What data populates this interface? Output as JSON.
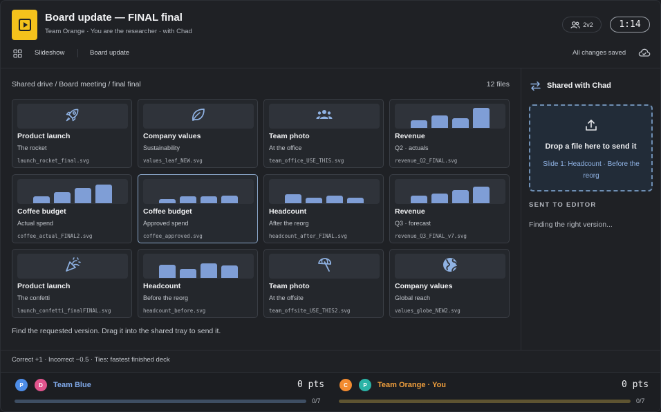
{
  "header": {
    "title": "Board update — FINAL final",
    "subtitle": "Team Orange · You are the researcher · with Chad",
    "mode_badge": "2v2",
    "timer": "1:14",
    "nav": {
      "slideshow": "Slideshow",
      "deck": "Board update"
    },
    "saved_status": "All changes saved"
  },
  "main": {
    "breadcrumb": "Shared drive / Board meeting / final final",
    "file_count": "12 files",
    "instruction": "Find the requested version. Drag it into the shared tray to send it.",
    "files": [
      {
        "title": "Product launch",
        "subtitle": "The rocket",
        "filename": "launch_rocket_final.svg",
        "thumb": "rocket-icon"
      },
      {
        "title": "Company values",
        "subtitle": "Sustainability",
        "filename": "values_leaf_NEW.svg",
        "thumb": "leaf-icon"
      },
      {
        "title": "Team photo",
        "subtitle": "At the office",
        "filename": "team_office_USE_THIS.svg",
        "thumb": "people-icon"
      },
      {
        "title": "Revenue",
        "subtitle": "Q2 · actuals",
        "filename": "revenue_Q2_FINAL.svg",
        "thumb": "bar-chart",
        "bars": [
          0.35,
          0.55,
          0.45,
          0.9
        ]
      },
      {
        "title": "Coffee budget",
        "subtitle": "Actual spend",
        "filename": "coffee_actual_FINAL2.svg",
        "thumb": "bar-chart",
        "bars": [
          0.3,
          0.5,
          0.7,
          0.85
        ]
      },
      {
        "title": "Coffee budget",
        "subtitle": "Approved spend",
        "filename": "coffee_approved.svg",
        "thumb": "bar-chart",
        "bars": [
          0.2,
          0.3,
          0.3,
          0.35
        ],
        "selected": true
      },
      {
        "title": "Headcount",
        "subtitle": "After the reorg",
        "filename": "headcount_after_FINAL.svg",
        "thumb": "bar-chart",
        "bars": [
          0.4,
          0.25,
          0.35,
          0.25
        ]
      },
      {
        "title": "Revenue",
        "subtitle": "Q3 · forecast",
        "filename": "revenue_Q3_FINAL_v7.svg",
        "thumb": "bar-chart",
        "bars": [
          0.35,
          0.45,
          0.6,
          0.75
        ]
      },
      {
        "title": "Product launch",
        "subtitle": "The confetti",
        "filename": "launch_confetti_finalFINAL.svg",
        "thumb": "confetti-icon"
      },
      {
        "title": "Headcount",
        "subtitle": "Before the reorg",
        "filename": "headcount_before.svg",
        "thumb": "bar-chart",
        "bars": [
          0.6,
          0.4,
          0.65,
          0.55
        ]
      },
      {
        "title": "Team photo",
        "subtitle": "At the offsite",
        "filename": "team_offsite_USE_THIS2.svg",
        "thumb": "beach-umbrella-icon"
      },
      {
        "title": "Company values",
        "subtitle": "Global reach",
        "filename": "values_globe_NEW2.svg",
        "thumb": "globe-icon"
      }
    ]
  },
  "side": {
    "title": "Shared with Chad",
    "drop_title": "Drop a file here to send it",
    "drop_sub": "Slide 1: Headcount · Before the reorg",
    "sent_label": "SENT TO EDITOR",
    "sent_status": "Finding the right version..."
  },
  "footer": {
    "rules": "Correct +1 · Incorrect −0.5 · Ties: fastest finished deck",
    "teams": [
      {
        "name": "Team Blue",
        "avatars": [
          {
            "letter": "P",
            "color": "#4d8de8"
          },
          {
            "letter": "D",
            "color": "#e0548c"
          }
        ],
        "score": "0 pts",
        "progress_text": "0/7",
        "progress": 0,
        "name_color": "#7fa8e8",
        "track_color": "#3e4e63"
      },
      {
        "name": "Team Orange · You",
        "avatars": [
          {
            "letter": "C",
            "color": "#f28b30"
          },
          {
            "letter": "P",
            "color": "#2bb3a6"
          }
        ],
        "score": "0 pts",
        "progress_text": "0/7",
        "progress": 0,
        "name_color": "#f2a03d",
        "track_color": "#5e5431"
      }
    ]
  },
  "colors": {
    "accent": "#f4c21c",
    "drop_border": "#6f8fb3",
    "link": "#8fb2e3"
  }
}
